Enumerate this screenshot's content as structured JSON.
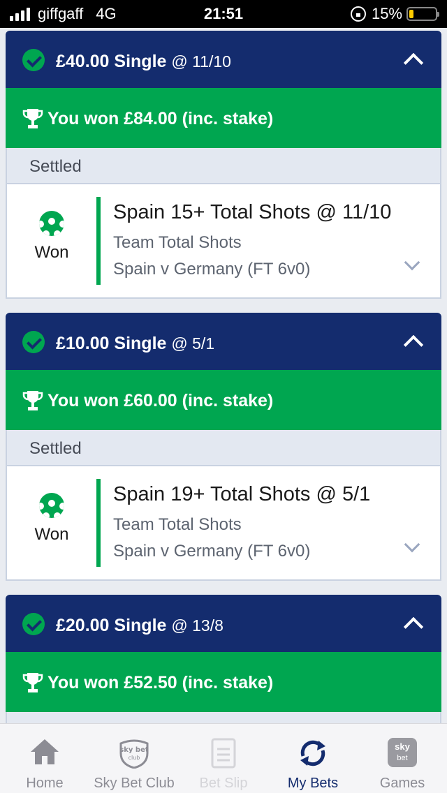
{
  "status_bar": {
    "carrier": "giffgaff",
    "network": "4G",
    "time": "21:51",
    "battery": "15%"
  },
  "colors": {
    "header_navy": "#142c6e",
    "win_green": "#00a650",
    "settled_bg": "#e3e8f1",
    "battery_yellow": "#ffcc00"
  },
  "bets": [
    {
      "stake_label": "£40.00 Single",
      "odds_label": "@ 11/10",
      "won_label": "You won £84.00 (inc. stake)",
      "status": "Settled",
      "outcome": "Won",
      "selection": "Spain 15+ Total Shots @ 11/10",
      "market": "Team Total Shots",
      "event": "Spain v Germany (FT 6v0)"
    },
    {
      "stake_label": "£10.00 Single",
      "odds_label": "@ 5/1",
      "won_label": "You won £60.00 (inc. stake)",
      "status": "Settled",
      "outcome": "Won",
      "selection": "Spain 19+ Total Shots @ 5/1",
      "market": "Team Total Shots",
      "event": "Spain v Germany (FT 6v0)"
    },
    {
      "stake_label": "£20.00 Single",
      "odds_label": "@ 13/8",
      "won_label": "You won £52.50 (inc. stake)"
    }
  ],
  "bottom_nav": {
    "home": "Home",
    "club": "Sky Bet Club",
    "club_badge_top": "sky bet",
    "club_badge_bottom": "club",
    "slip": "Bet Slip",
    "mybets": "My Bets",
    "games": "Games",
    "games_badge_top": "sky",
    "games_badge_bottom": "bet",
    "active": "My Bets"
  }
}
